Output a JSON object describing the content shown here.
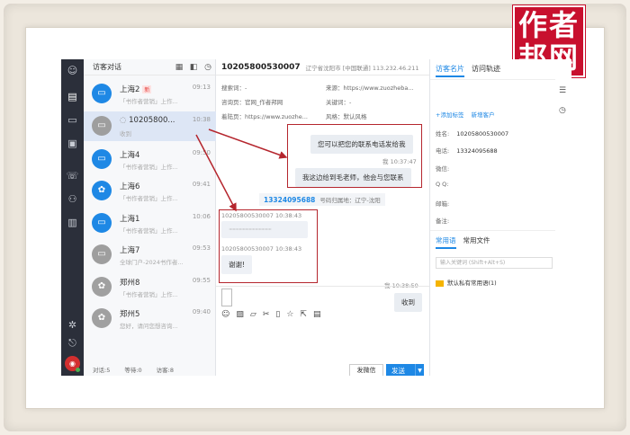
{
  "logo": {
    "line1": "作者",
    "line2": "邦网"
  },
  "list": {
    "title": "访客对话",
    "items": [
      {
        "name": "上海2",
        "tag": "新",
        "time": "09:13",
        "preview": "「书作者营销」上作...",
        "avatar": "monitor"
      },
      {
        "name": "10205800...",
        "tag": "",
        "time": "10:38",
        "preview": "收到",
        "avatar": "monitor-chat"
      },
      {
        "name": "上海4",
        "tag": "",
        "time": "09:50",
        "preview": "「书作者营销」上作...",
        "avatar": "monitor"
      },
      {
        "name": "上海6",
        "tag": "",
        "time": "09:41",
        "preview": "「书作者营销」上作...",
        "avatar": "paw"
      },
      {
        "name": "上海1",
        "tag": "",
        "time": "10:06",
        "preview": "「书作者营销」上作...",
        "avatar": "monitor"
      },
      {
        "name": "上海7",
        "tag": "",
        "time": "09:53",
        "preview": "全球门户-2024书作者...",
        "avatar": "monitor"
      },
      {
        "name": "郑州8",
        "tag": "",
        "time": "09:55",
        "preview": "「书作者营销」上作...",
        "avatar": "paw"
      },
      {
        "name": "郑州5",
        "tag": "",
        "time": "09:40",
        "preview": "您好，请问您想咨询...",
        "avatar": "paw"
      }
    ],
    "footer": {
      "dialog": "对话:5",
      "waiting": "等待:0",
      "visitors": "访客:8"
    }
  },
  "chat": {
    "visitor_id": "10205800530007",
    "location": "辽宁省沈阳市 [中国联通] 113.232.46.211",
    "info": {
      "search_engine": "搜索词：-",
      "consult_page": "咨询页：官网_作者邦网",
      "source_page": "来源：https://www.zuozheba...",
      "landing": "着陆页：https://www.zuozhe...",
      "keyword": "关键词：-",
      "style": "风格：默认风格"
    },
    "messages": [
      {
        "text": "您可以把您的联系电话发给我",
        "meta": "我 10:37:47",
        "text2": "我这边给到毛老师，他会与您联系"
      },
      {
        "system_phone": "13324095688",
        "system_text": "号码归属地：辽宁-沈阳"
      },
      {
        "sender": "10205800530007 10:38:43",
        "masked": "··································"
      },
      {
        "sender": "10205800530007 10:38:43",
        "text": "谢谢!"
      },
      {
        "meta": "我 10:38:50",
        "text": "收到"
      }
    ],
    "buttons": {
      "wechat": "发微信",
      "send": "发送"
    }
  },
  "side": {
    "tabs": [
      "访客名片",
      "访问轨迹"
    ],
    "links": [
      "+添加标签",
      "新增客户"
    ],
    "fields": [
      {
        "label": "姓名:",
        "value": "10205800530007"
      },
      {
        "label": "电话:",
        "value": "13324095688"
      },
      {
        "label": "微信:",
        "value": ""
      },
      {
        "label": "Q Q:",
        "value": ""
      },
      {
        "label": "邮箱:",
        "value": ""
      },
      {
        "label": "备注:",
        "value": ""
      }
    ],
    "tabs2": [
      "常用语",
      "常用文件"
    ],
    "search_placeholder": "输入关键词 (Shift+Alt+S)",
    "folder": "默认私有常用语(1)"
  }
}
